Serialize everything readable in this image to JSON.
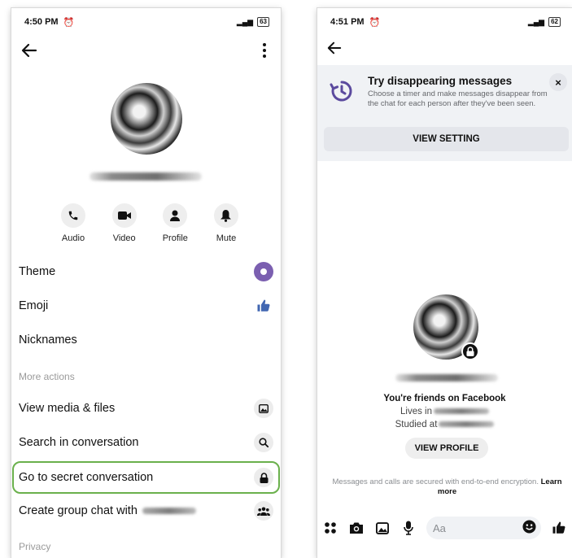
{
  "left": {
    "status_time": "4:50 PM",
    "battery": "63",
    "actions": [
      {
        "label": "Audio",
        "icon": "phone-icon"
      },
      {
        "label": "Video",
        "icon": "video-camera-icon"
      },
      {
        "label": "Profile",
        "icon": "person-icon"
      },
      {
        "label": "Mute",
        "icon": "bell-icon"
      }
    ],
    "menu": {
      "theme": "Theme",
      "emoji": "Emoji",
      "nicknames": "Nicknames",
      "more_actions": "More actions",
      "view_media": "View media & files",
      "search": "Search in conversation",
      "secret": "Go to secret conversation",
      "group_chat": "Create group chat with",
      "privacy": "Privacy"
    },
    "colors": {
      "theme_accent": "#7b5fb0",
      "like_blue": "#4267b2",
      "highlight_green": "#6ab04c"
    }
  },
  "right": {
    "status_time": "4:51 PM",
    "battery": "62",
    "banner": {
      "title": "Try disappearing messages",
      "body": "Choose a timer and make messages disappear from the chat for each person after they've been seen.",
      "button": "VIEW SETTING",
      "close": "×"
    },
    "friends_text": "You're friends on Facebook",
    "lives_in": "Lives in",
    "studied_at": "Studied at",
    "view_profile": "VIEW PROFILE",
    "e2e_text": "Messages and calls are secured with end-to-end encryption.",
    "e2e_link": "Learn more",
    "composer_placeholder": "Aa",
    "colors": {
      "accent_purple": "#5b4a9e"
    }
  }
}
